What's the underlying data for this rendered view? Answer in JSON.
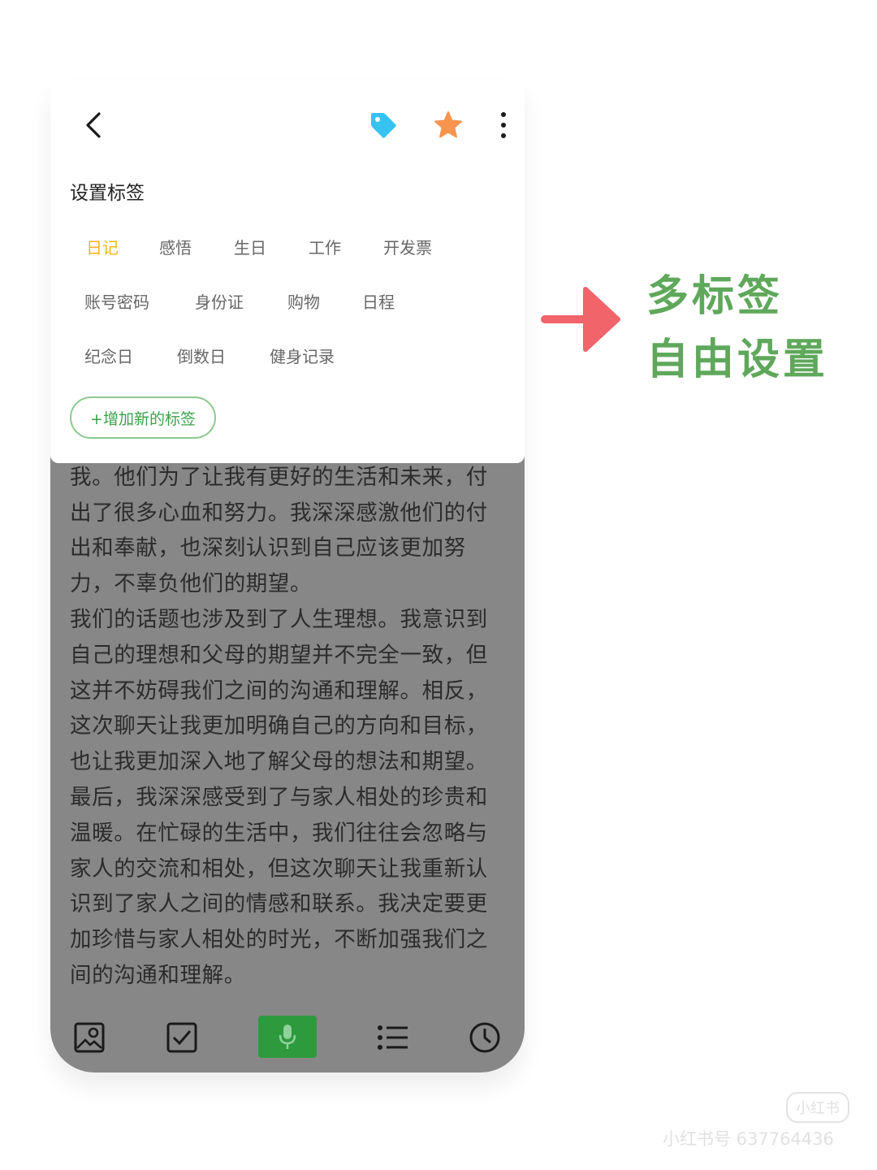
{
  "header": {
    "back_icon": "chevron-left-icon",
    "tag_icon": "tag-icon",
    "star_icon": "star-icon",
    "more_icon": "more-vertical-icon",
    "tag_color": "#36c3f0",
    "star_color": "#f8944f"
  },
  "tag_panel": {
    "title": "设置标签",
    "tags": [
      {
        "label": "日记",
        "active": true
      },
      {
        "label": "感悟",
        "active": false
      },
      {
        "label": "生日",
        "active": false
      },
      {
        "label": "工作",
        "active": false
      },
      {
        "label": "开发票",
        "active": false
      },
      {
        "label": "账号密码",
        "active": false
      },
      {
        "label": "身份证",
        "active": false
      },
      {
        "label": "购物",
        "active": false
      },
      {
        "label": "日程",
        "active": false
      },
      {
        "label": "纪念日",
        "active": false
      },
      {
        "label": "倒数日",
        "active": false
      },
      {
        "label": "健身记录",
        "active": false
      }
    ],
    "add_button": "+增加新的标签",
    "active_color": "#f2b619"
  },
  "note": {
    "paragraphs": [
      "成长过程中，父母一直在默默地支持和鼓励我。他们为了让我有更好的生活和未来，付出了很多心血和努力。我深深感激他们的付出和奉献，也深刻认识到自己应该更加努力，不辜负他们的期望。",
      "我们的话题也涉及到了人生理想。我意识到自己的理想和父母的期望并不完全一致，但这并不妨碍我们之间的沟通和理解。相反，这次聊天让我更加明确自己的方向和目标，也让我更加深入地了解父母的想法和期望。",
      "最后，我深深感受到了与家人相处的珍贵和温暖。在忙碌的生活中，我们往往会忽略与家人的交流和相处，但这次聊天让我重新认识到了家人之间的情感和联系。我决定要更加珍惜与家人相处的时光，不断加强我们之间的沟通和理解。"
    ]
  },
  "toolbar": {
    "items": [
      "image-icon",
      "checkbox-icon",
      "microphone-icon",
      "list-icon",
      "clock-icon"
    ],
    "mic_color": "#2e9a3e"
  },
  "callout": {
    "line1": "多标签",
    "line2": "自由设置",
    "text_color": "#5fa85b",
    "arrow_color": "#f0646a"
  },
  "watermark": {
    "logo": "小红书",
    "id_text": "小红书号 637764436"
  }
}
